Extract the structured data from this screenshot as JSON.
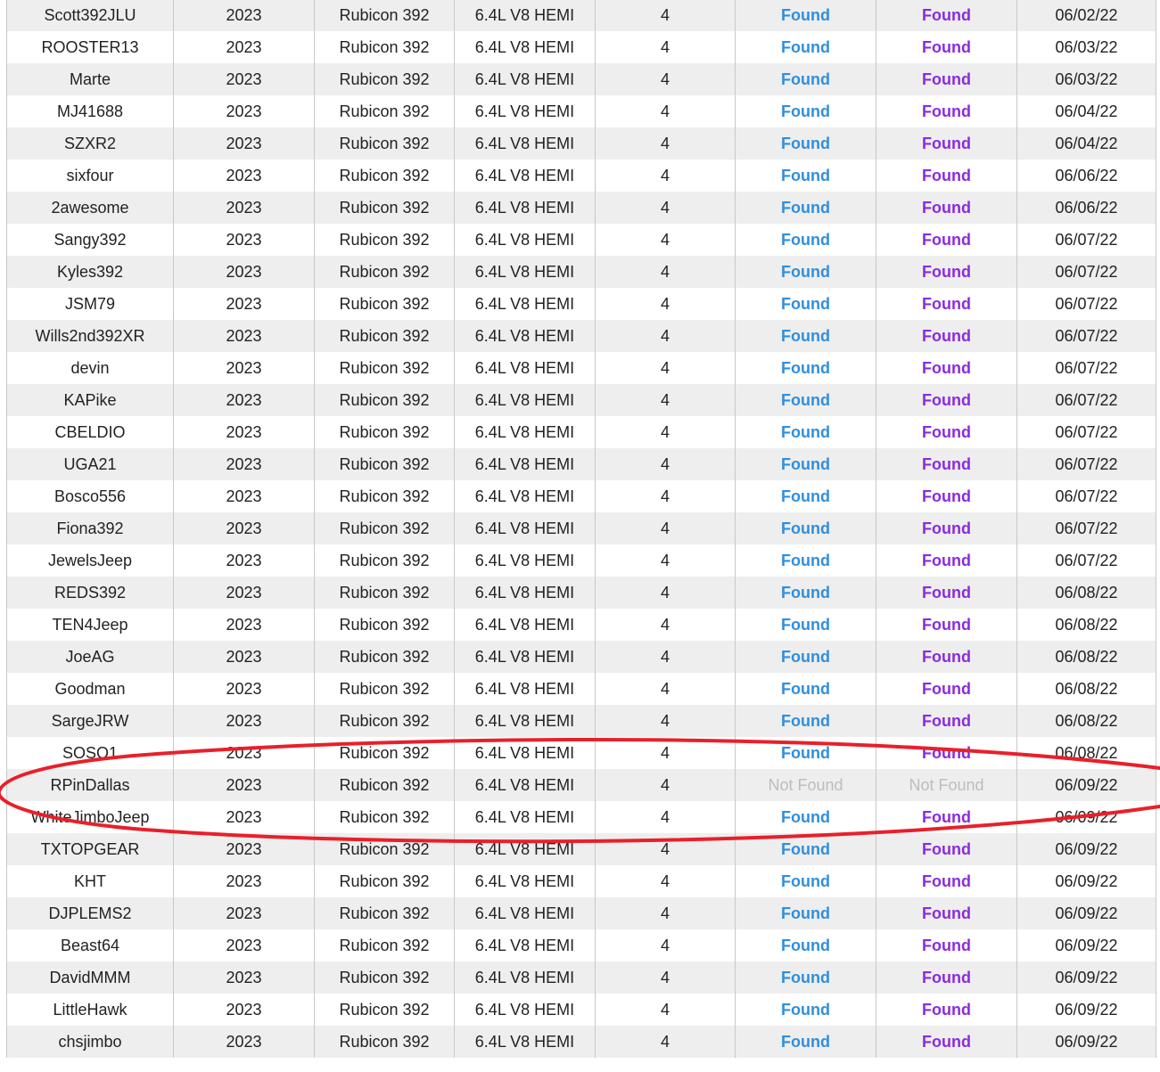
{
  "table": {
    "rows": [
      {
        "user": "Scott392JLU",
        "year": "2023",
        "model": "Rubicon 392",
        "engine": "6.4L V8 HEMI",
        "doors": "4",
        "status_a": "Found",
        "status_b": "Found",
        "date": "06/02/22"
      },
      {
        "user": "ROOSTER13",
        "year": "2023",
        "model": "Rubicon 392",
        "engine": "6.4L V8 HEMI",
        "doors": "4",
        "status_a": "Found",
        "status_b": "Found",
        "date": "06/03/22"
      },
      {
        "user": "Marte",
        "year": "2023",
        "model": "Rubicon 392",
        "engine": "6.4L V8 HEMI",
        "doors": "4",
        "status_a": "Found",
        "status_b": "Found",
        "date": "06/03/22"
      },
      {
        "user": "MJ41688",
        "year": "2023",
        "model": "Rubicon 392",
        "engine": "6.4L V8 HEMI",
        "doors": "4",
        "status_a": "Found",
        "status_b": "Found",
        "date": "06/04/22"
      },
      {
        "user": "SZXR2",
        "year": "2023",
        "model": "Rubicon 392",
        "engine": "6.4L V8 HEMI",
        "doors": "4",
        "status_a": "Found",
        "status_b": "Found",
        "date": "06/04/22"
      },
      {
        "user": "sixfour",
        "year": "2023",
        "model": "Rubicon 392",
        "engine": "6.4L V8 HEMI",
        "doors": "4",
        "status_a": "Found",
        "status_b": "Found",
        "date": "06/06/22"
      },
      {
        "user": "2awesome",
        "year": "2023",
        "model": "Rubicon 392",
        "engine": "6.4L V8 HEMI",
        "doors": "4",
        "status_a": "Found",
        "status_b": "Found",
        "date": "06/06/22"
      },
      {
        "user": "Sangy392",
        "year": "2023",
        "model": "Rubicon 392",
        "engine": "6.4L V8 HEMI",
        "doors": "4",
        "status_a": "Found",
        "status_b": "Found",
        "date": "06/07/22"
      },
      {
        "user": "Kyles392",
        "year": "2023",
        "model": "Rubicon 392",
        "engine": "6.4L V8 HEMI",
        "doors": "4",
        "status_a": "Found",
        "status_b": "Found",
        "date": "06/07/22"
      },
      {
        "user": "JSM79",
        "year": "2023",
        "model": "Rubicon 392",
        "engine": "6.4L V8 HEMI",
        "doors": "4",
        "status_a": "Found",
        "status_b": "Found",
        "date": "06/07/22"
      },
      {
        "user": "Wills2nd392XR",
        "year": "2023",
        "model": "Rubicon 392",
        "engine": "6.4L V8 HEMI",
        "doors": "4",
        "status_a": "Found",
        "status_b": "Found",
        "date": "06/07/22"
      },
      {
        "user": "devin",
        "year": "2023",
        "model": "Rubicon 392",
        "engine": "6.4L V8 HEMI",
        "doors": "4",
        "status_a": "Found",
        "status_b": "Found",
        "date": "06/07/22"
      },
      {
        "user": "KAPike",
        "year": "2023",
        "model": "Rubicon 392",
        "engine": "6.4L V8 HEMI",
        "doors": "4",
        "status_a": "Found",
        "status_b": "Found",
        "date": "06/07/22"
      },
      {
        "user": "CBELDIO",
        "year": "2023",
        "model": "Rubicon 392",
        "engine": "6.4L V8 HEMI",
        "doors": "4",
        "status_a": "Found",
        "status_b": "Found",
        "date": "06/07/22"
      },
      {
        "user": "UGA21",
        "year": "2023",
        "model": "Rubicon 392",
        "engine": "6.4L V8 HEMI",
        "doors": "4",
        "status_a": "Found",
        "status_b": "Found",
        "date": "06/07/22"
      },
      {
        "user": "Bosco556",
        "year": "2023",
        "model": "Rubicon 392",
        "engine": "6.4L V8 HEMI",
        "doors": "4",
        "status_a": "Found",
        "status_b": "Found",
        "date": "06/07/22"
      },
      {
        "user": "Fiona392",
        "year": "2023",
        "model": "Rubicon 392",
        "engine": "6.4L V8 HEMI",
        "doors": "4",
        "status_a": "Found",
        "status_b": "Found",
        "date": "06/07/22"
      },
      {
        "user": "JewelsJeep",
        "year": "2023",
        "model": "Rubicon 392",
        "engine": "6.4L V8 HEMI",
        "doors": "4",
        "status_a": "Found",
        "status_b": "Found",
        "date": "06/07/22"
      },
      {
        "user": "REDS392",
        "year": "2023",
        "model": "Rubicon 392",
        "engine": "6.4L V8 HEMI",
        "doors": "4",
        "status_a": "Found",
        "status_b": "Found",
        "date": "06/08/22"
      },
      {
        "user": "TEN4Jeep",
        "year": "2023",
        "model": "Rubicon 392",
        "engine": "6.4L V8 HEMI",
        "doors": "4",
        "status_a": "Found",
        "status_b": "Found",
        "date": "06/08/22"
      },
      {
        "user": "JoeAG",
        "year": "2023",
        "model": "Rubicon 392",
        "engine": "6.4L V8 HEMI",
        "doors": "4",
        "status_a": "Found",
        "status_b": "Found",
        "date": "06/08/22"
      },
      {
        "user": "Goodman",
        "year": "2023",
        "model": "Rubicon 392",
        "engine": "6.4L V8 HEMI",
        "doors": "4",
        "status_a": "Found",
        "status_b": "Found",
        "date": "06/08/22"
      },
      {
        "user": "SargeJRW",
        "year": "2023",
        "model": "Rubicon 392",
        "engine": "6.4L V8 HEMI",
        "doors": "4",
        "status_a": "Found",
        "status_b": "Found",
        "date": "06/08/22"
      },
      {
        "user": "SOSO1",
        "year": "2023",
        "model": "Rubicon 392",
        "engine": "6.4L V8 HEMI",
        "doors": "4",
        "status_a": "Found",
        "status_b": "Found",
        "date": "06/08/22"
      },
      {
        "user": "RPinDallas",
        "year": "2023",
        "model": "Rubicon 392",
        "engine": "6.4L V8 HEMI",
        "doors": "4",
        "status_a": "Not Found",
        "status_b": "Not Found",
        "date": "06/09/22"
      },
      {
        "user": "WhiteJimboJeep",
        "year": "2023",
        "model": "Rubicon 392",
        "engine": "6.4L V8 HEMI",
        "doors": "4",
        "status_a": "Found",
        "status_b": "Found",
        "date": "06/09/22"
      },
      {
        "user": "TXTOPGEAR",
        "year": "2023",
        "model": "Rubicon 392",
        "engine": "6.4L V8 HEMI",
        "doors": "4",
        "status_a": "Found",
        "status_b": "Found",
        "date": "06/09/22"
      },
      {
        "user": "KHT",
        "year": "2023",
        "model": "Rubicon 392",
        "engine": "6.4L V8 HEMI",
        "doors": "4",
        "status_a": "Found",
        "status_b": "Found",
        "date": "06/09/22"
      },
      {
        "user": "DJPLEMS2",
        "year": "2023",
        "model": "Rubicon 392",
        "engine": "6.4L V8 HEMI",
        "doors": "4",
        "status_a": "Found",
        "status_b": "Found",
        "date": "06/09/22"
      },
      {
        "user": "Beast64",
        "year": "2023",
        "model": "Rubicon 392",
        "engine": "6.4L V8 HEMI",
        "doors": "4",
        "status_a": "Found",
        "status_b": "Found",
        "date": "06/09/22"
      },
      {
        "user": "DavidMMM",
        "year": "2023",
        "model": "Rubicon 392",
        "engine": "6.4L V8 HEMI",
        "doors": "4",
        "status_a": "Found",
        "status_b": "Found",
        "date": "06/09/22"
      },
      {
        "user": "LittleHawk",
        "year": "2023",
        "model": "Rubicon 392",
        "engine": "6.4L V8 HEMI",
        "doors": "4",
        "status_a": "Found",
        "status_b": "Found",
        "date": "06/09/22"
      },
      {
        "user": "chsjimbo",
        "year": "2023",
        "model": "Rubicon 392",
        "engine": "6.4L V8 HEMI",
        "doors": "4",
        "status_a": "Found",
        "status_b": "Found",
        "date": "06/09/22"
      }
    ]
  },
  "colors": {
    "status_a_found": "#2e8fe0",
    "status_b_found": "#8a2be2",
    "not_found": "#bdbdbd",
    "row_stripe": "#eeeeee",
    "annotation": "#e8202a"
  },
  "annotation": {
    "shape": "hand-drawn-ellipse",
    "highlighted_users": [
      "SOSO1",
      "RPinDallas",
      "WhiteJimboJeep"
    ]
  }
}
